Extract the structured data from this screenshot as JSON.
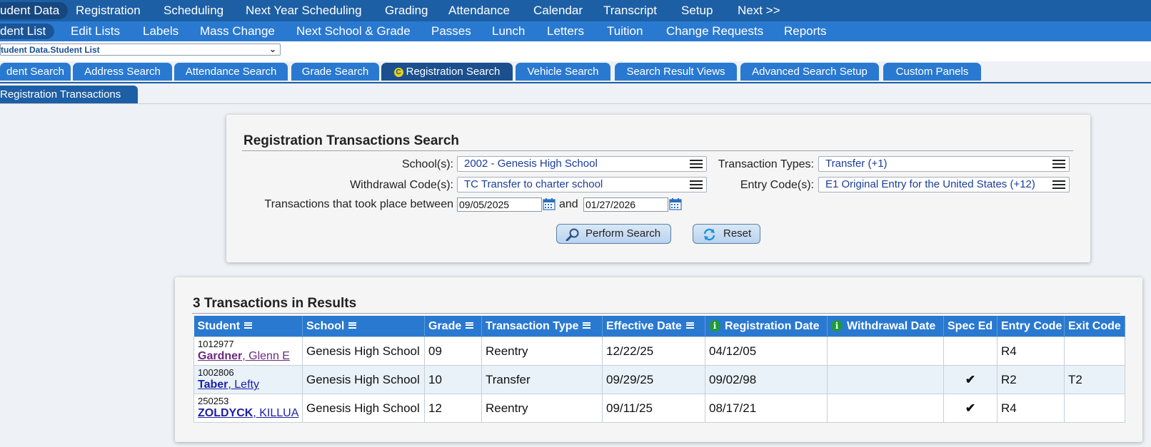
{
  "nav_primary": [
    {
      "label": "udent Data",
      "active": true
    },
    {
      "label": "Registration"
    },
    {
      "label": "Scheduling"
    },
    {
      "label": "Next Year Scheduling"
    },
    {
      "label": "Grading"
    },
    {
      "label": "Attendance"
    },
    {
      "label": "Calendar"
    },
    {
      "label": "Transcript"
    },
    {
      "label": "Setup"
    },
    {
      "label": "Next >>"
    }
  ],
  "nav_secondary": [
    {
      "label": "dent List",
      "active": true
    },
    {
      "label": "Edit Lists"
    },
    {
      "label": "Labels"
    },
    {
      "label": "Mass Change"
    },
    {
      "label": "Next School & Grade"
    },
    {
      "label": "Passes"
    },
    {
      "label": "Lunch"
    },
    {
      "label": "Letters"
    },
    {
      "label": "Tuition"
    },
    {
      "label": "Change Requests"
    },
    {
      "label": "Reports"
    }
  ],
  "breadcrumb_select": "tudent Data.Student List",
  "search_tabs": [
    {
      "label": "dent Search"
    },
    {
      "label": "Address Search"
    },
    {
      "label": "Attendance Search"
    },
    {
      "label": "Grade Search"
    },
    {
      "label": "Registration Search",
      "active": true,
      "icon": "c-circle-icon"
    },
    {
      "label": "Vehicle Search"
    },
    {
      "label": "Search Result Views"
    },
    {
      "label": "Advanced Search Setup"
    },
    {
      "label": "Custom Panels"
    }
  ],
  "sub_tab": "Registration Transactions",
  "search": {
    "title": "Registration Transactions Search",
    "schools_label": "School(s):",
    "schools_value": "2002 - Genesis High School",
    "transaction_types_label": "Transaction Types:",
    "transaction_types_value": "Transfer (+1)",
    "withdrawal_label": "Withdrawal Code(s):",
    "withdrawal_value": "TC Transfer to charter school",
    "entry_label": "Entry Code(s):",
    "entry_value": "E1 Original Entry for the United States (+12)",
    "between_label": "Transactions that took place between",
    "date_from": "09/05/2025",
    "and_label": "and",
    "date_to": "01/27/2026",
    "perform_button": "Perform Search",
    "reset_button": "Reset"
  },
  "results": {
    "title": "3 Transactions in Results",
    "columns": [
      "Student",
      "School",
      "Grade",
      "Transaction Type",
      "Effective Date",
      "Registration Date",
      "Withdrawal Date",
      "Spec Ed",
      "Entry Code",
      "Exit Code"
    ],
    "rows": [
      {
        "id": "1012977",
        "last": "Gardner",
        "first": ", Glenn E",
        "school": "Genesis High School",
        "grade": "09",
        "type": "Reentry",
        "effective": "12/22/25",
        "registration": "04/12/05",
        "withdrawal": "",
        "spec_ed": "",
        "entry": "R4",
        "exit": ""
      },
      {
        "id": "1002806",
        "last": "Taber",
        "first": ", Lefty",
        "school": "Genesis High School",
        "grade": "10",
        "type": "Transfer",
        "effective": "09/29/25",
        "registration": "09/02/98",
        "withdrawal": "",
        "spec_ed": "✔",
        "entry": "R2",
        "exit": "T2"
      },
      {
        "id": "250253",
        "last": "ZOLDYCK",
        "first": ", KILLUA",
        "school": "Genesis High School",
        "grade": "12",
        "type": "Reentry",
        "effective": "09/11/25",
        "registration": "08/17/21",
        "withdrawal": "",
        "spec_ed": "✔",
        "entry": "R4",
        "exit": ""
      }
    ]
  }
}
